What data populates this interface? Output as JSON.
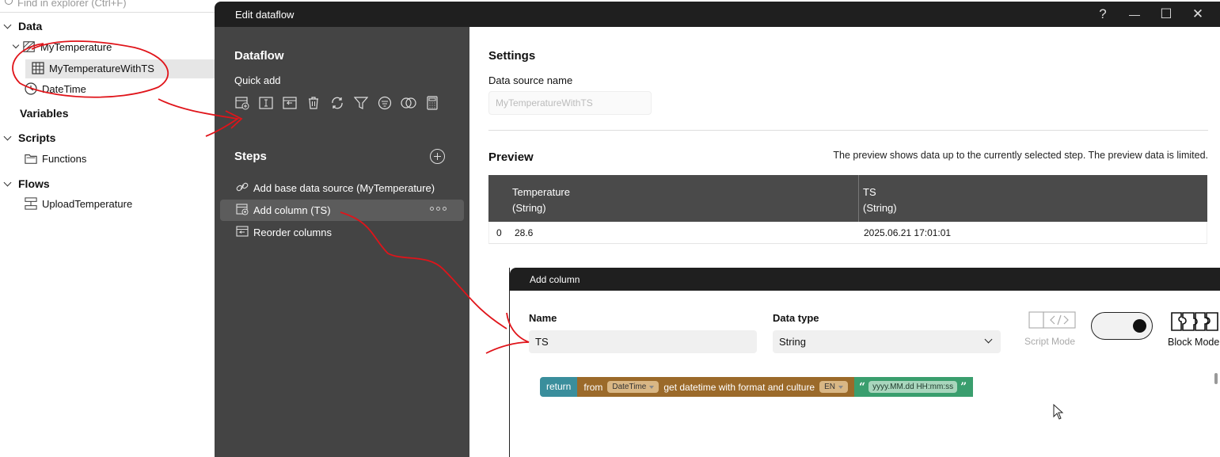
{
  "explorer": {
    "search_placeholder": "Find in explorer (Ctrl+F)",
    "sections": {
      "data": "Data",
      "variables": "Variables",
      "scripts": "Scripts",
      "flows": "Flows"
    },
    "items": {
      "my_temperature": "MyTemperature",
      "my_temperature_ts": "MyTemperatureWithTS",
      "datetime": "DateTime",
      "functions": "Functions",
      "upload_temperature": "UploadTemperature"
    }
  },
  "window": {
    "title": "Edit dataflow",
    "help": "?",
    "minimize": "—",
    "maximize": "☐",
    "close": "✕"
  },
  "sidebar": {
    "heading": "Dataflow",
    "quick_add": "Quick add",
    "steps_heading": "Steps",
    "steps": [
      {
        "label": "Add base data source (MyTemperature)"
      },
      {
        "label": "Add column (TS)"
      },
      {
        "label": "Reorder columns"
      }
    ]
  },
  "settings": {
    "heading": "Settings",
    "data_source_label": "Data source name",
    "data_source_placeholder": "MyTemperatureWithTS"
  },
  "preview": {
    "heading": "Preview",
    "note": "The preview shows data up to the currently selected step. The preview data is limited.",
    "columns": [
      {
        "name": "Temperature",
        "type": "(String)"
      },
      {
        "name": "TS",
        "type": "(String)"
      }
    ],
    "rows": [
      {
        "index": "0",
        "temperature": "28.6",
        "ts": "2025.06.21 17:01:01"
      }
    ]
  },
  "add_column": {
    "title": "Add column",
    "name_label": "Name",
    "name_value": "TS",
    "type_label": "Data type",
    "type_value": "String",
    "script_mode": "Script Mode",
    "block_mode": "Block Mode",
    "blocks": {
      "return": "return",
      "from": "from",
      "source": "DateTime",
      "get_text": "get datetime with format and culture",
      "culture": "EN",
      "format": "yyyy.MM.dd HH:mm:ss",
      "quote_open": "“",
      "quote_close": "”"
    }
  },
  "colors": {
    "titlebar": "#1f1f1f",
    "sidebar": "#444444",
    "table_header": "#4a4a4a",
    "block_return": "#3a8e9c",
    "block_datetime": "#9b6a2a",
    "block_string": "#3a9e6e",
    "annotation": "#e0141a"
  }
}
